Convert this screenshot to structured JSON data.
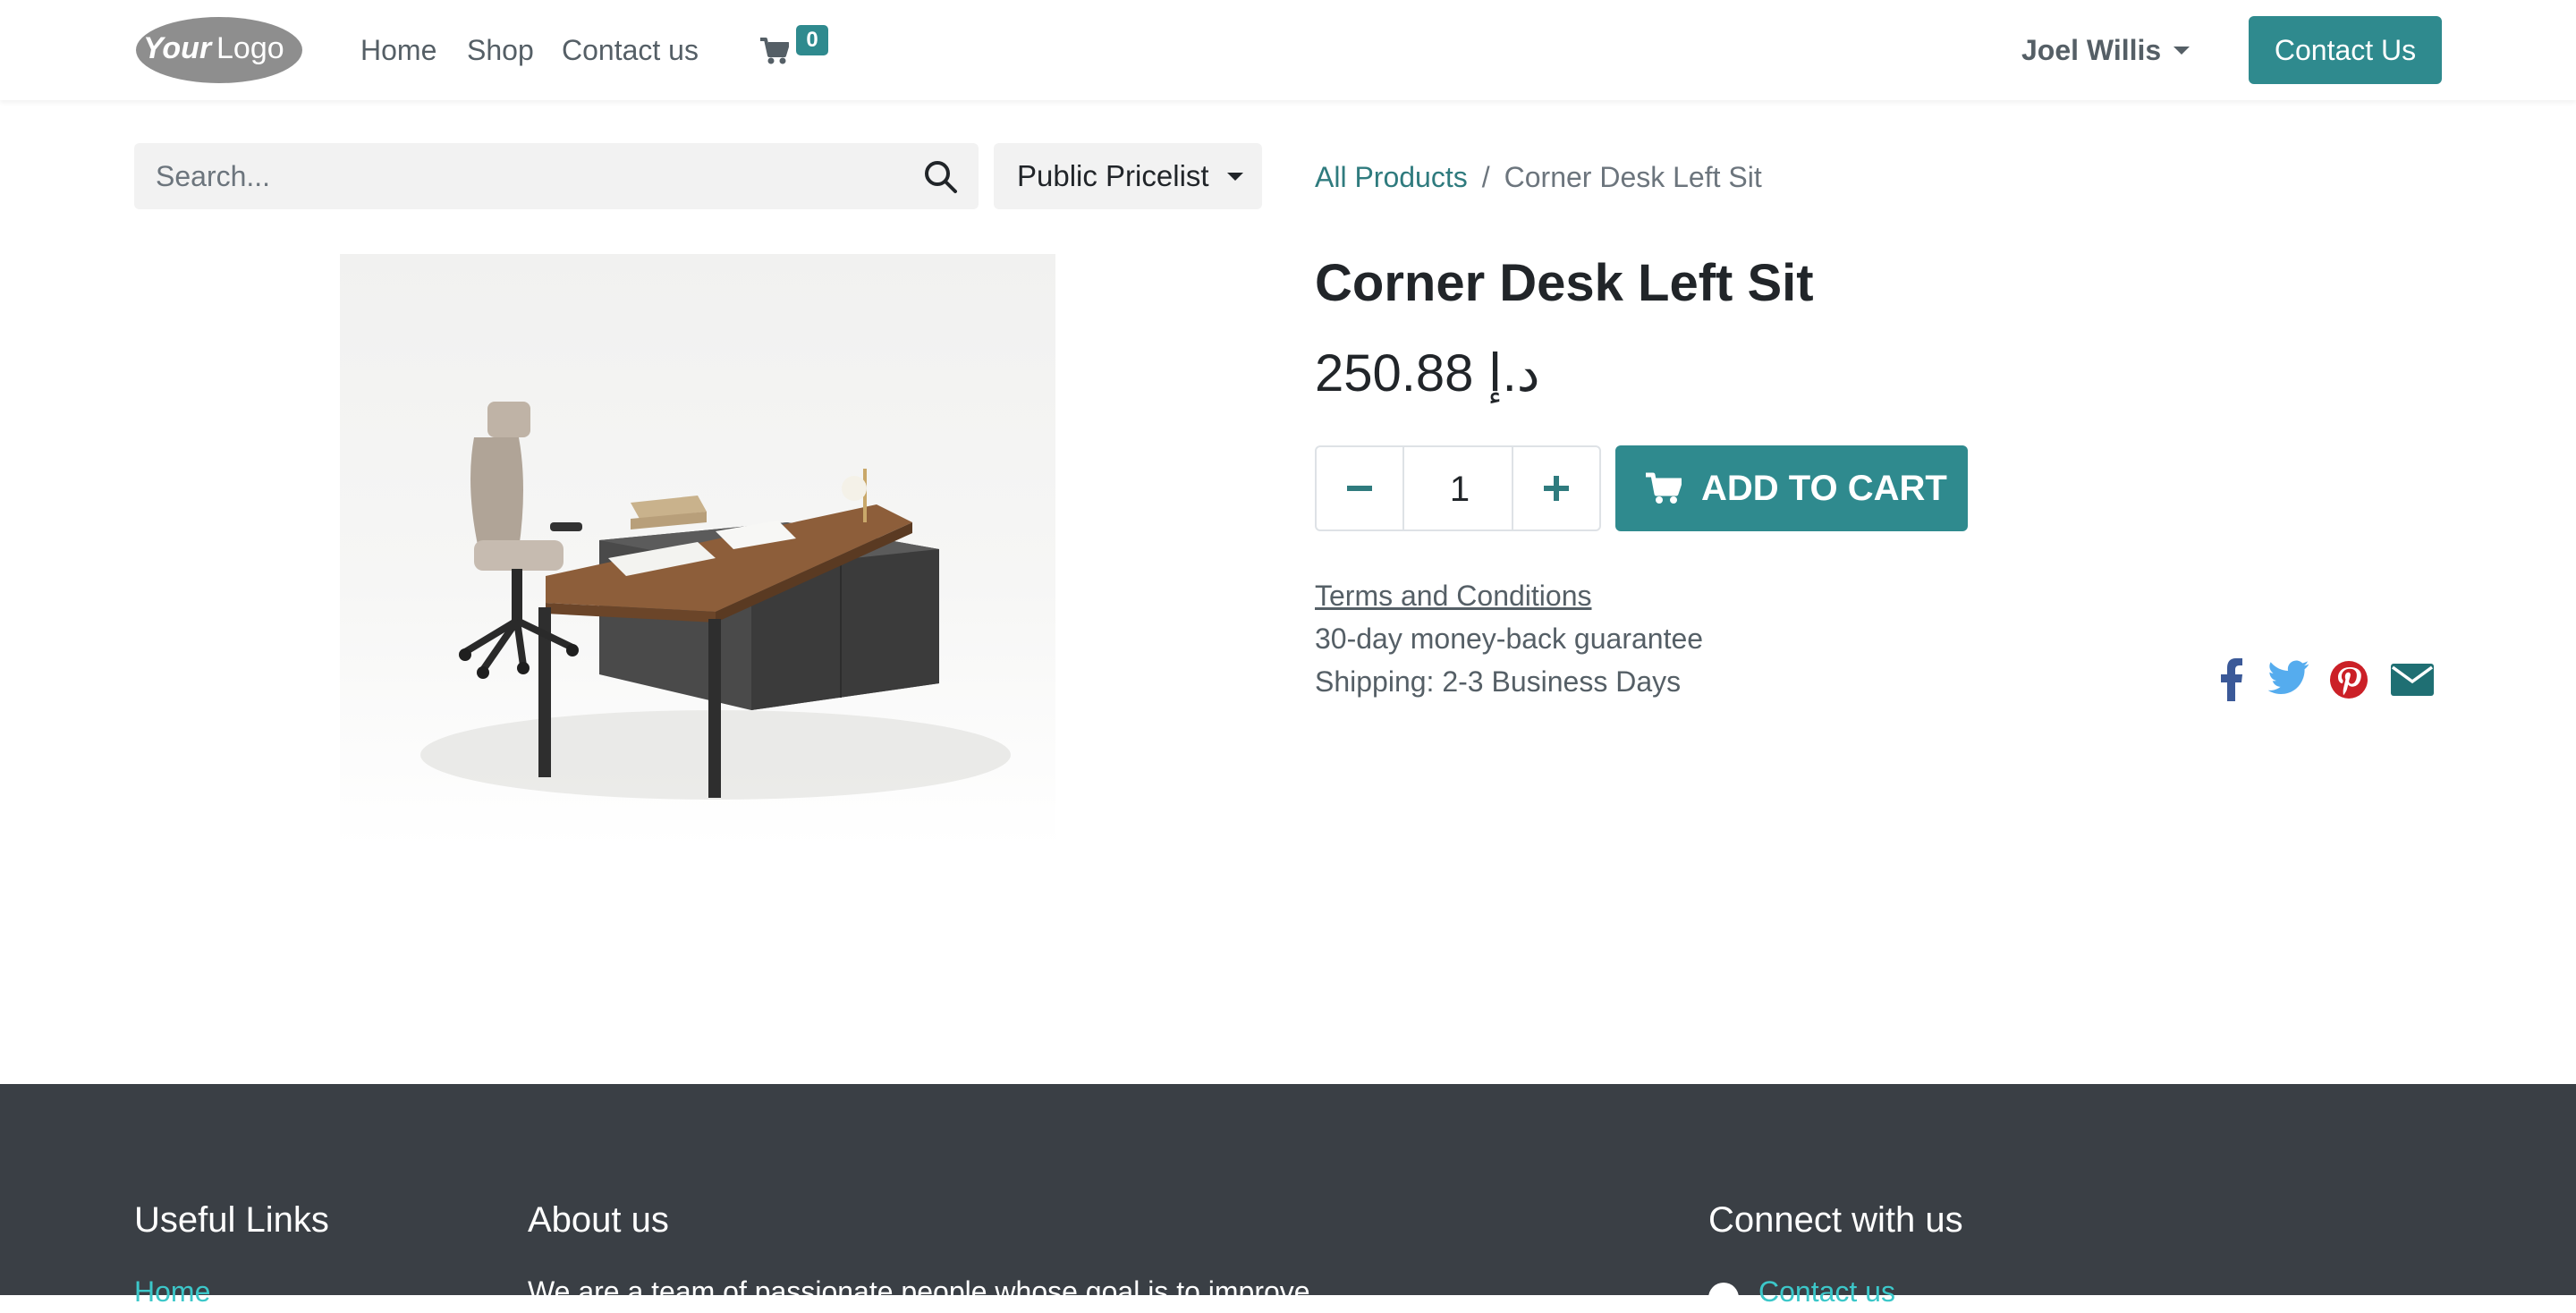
{
  "header": {
    "logo_text": "YourLogo",
    "nav": [
      {
        "label": "Home"
      },
      {
        "label": "Shop"
      },
      {
        "label": "Contact us"
      }
    ],
    "cart_count": "0",
    "user_name": "Joel Willis",
    "contact_button": "Contact Us"
  },
  "search": {
    "placeholder": "Search...",
    "pricelist": "Public Pricelist"
  },
  "breadcrumb": {
    "parent": "All Products",
    "separator": "/",
    "current": "Corner Desk Left Sit"
  },
  "product": {
    "title": "Corner Desk Left Sit",
    "price": "250.88 د.إ",
    "quantity": "1",
    "add_to_cart": "ADD TO CART",
    "terms": "Terms and Conditions",
    "guarantee": "30-day money-back guarantee",
    "shipping": "Shipping: 2-3 Business Days"
  },
  "social": [
    {
      "icon": "facebook-icon",
      "color": "#3b5998"
    },
    {
      "icon": "twitter-icon",
      "color": "#55acee"
    },
    {
      "icon": "pinterest-icon",
      "color": "#cb2027"
    },
    {
      "icon": "email-icon",
      "color": "#1f6f73"
    }
  ],
  "footer": {
    "useful_links_heading": "Useful Links",
    "useful_links": [
      {
        "label": "Home"
      }
    ],
    "about_heading": "About us",
    "about_text": "We are a team of passionate people whose goal is to improve",
    "connect_heading": "Connect with us",
    "connect_links": [
      {
        "label": "Contact us"
      }
    ]
  },
  "colors": {
    "accent": "#2f8a8e",
    "footer_bg": "#3a3f45",
    "footer_link": "#3cc7c9"
  }
}
